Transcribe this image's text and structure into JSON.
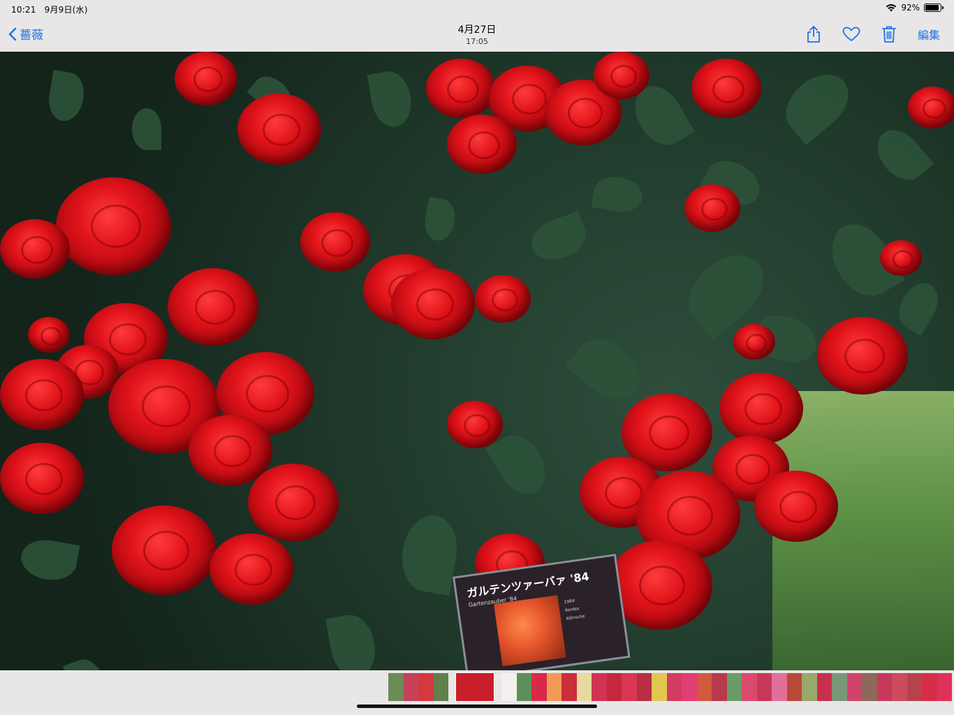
{
  "status_bar": {
    "time": "10:21",
    "date": "9月9日(水)",
    "battery_percent": "92%",
    "battery_level": 0.92
  },
  "nav": {
    "back_label": "薔薇",
    "title_date": "4月27日",
    "title_time": "17:05",
    "edit_label": "編集",
    "icons": [
      "share-icon",
      "heart-icon",
      "trash-icon"
    ],
    "accent_color": "#1a73e8"
  },
  "photo": {
    "plaque": {
      "title": "ガルテンツァーバァ '84",
      "subtitle": "Gartenzauber '84",
      "info": [
        "1984",
        "Kordes",
        "Kölnsche"
      ]
    }
  },
  "filmstrip": {
    "thumbs_before": [
      "#6a8c55",
      "#c74058",
      "#d23a3e",
      "#5f7f4d"
    ],
    "current_thumb": "#c81f2a",
    "thumbs_after": [
      "#f3f0ee",
      "#5e8f5a",
      "#d8294a",
      "#f29a55",
      "#cc2e3a",
      "#e8d9a0",
      "#d03454",
      "#c5283a",
      "#d93555",
      "#b92e44",
      "#e0c850",
      "#d23c60",
      "#e03e74",
      "#cf5a40",
      "#b83a4c",
      "#6a9c6a",
      "#d94b6c",
      "#c9365a",
      "#e0709a",
      "#b94a3a",
      "#9aa86a",
      "#c93050",
      "#7a9878",
      "#d1446a",
      "#8b6a5a",
      "#c8385a",
      "#cc4b5e",
      "#b7424e",
      "#d72e48",
      "#e0305a"
    ]
  }
}
